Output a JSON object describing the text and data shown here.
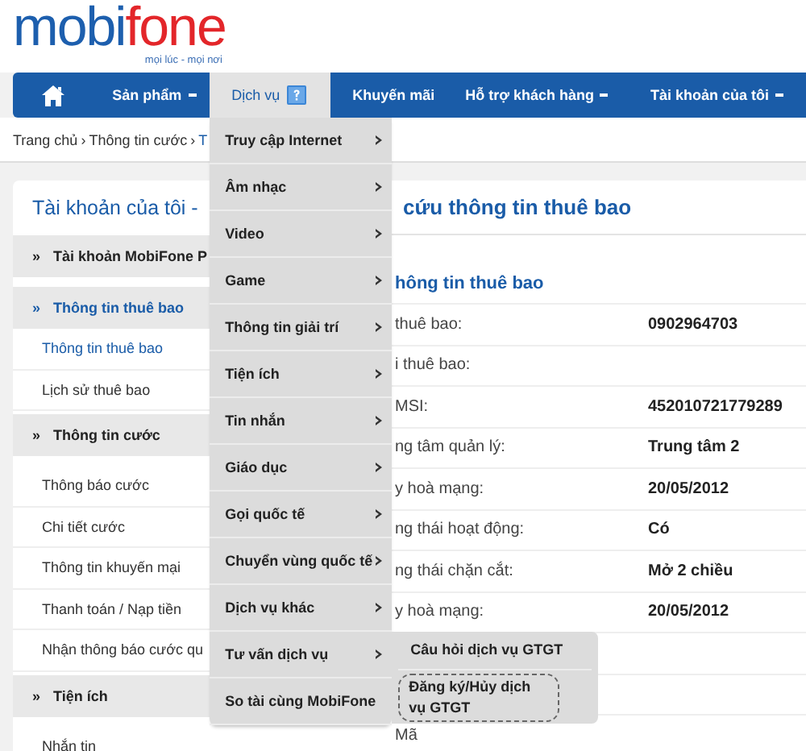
{
  "logo": {
    "part1": "mobi",
    "part2": "fone",
    "tagline": "mọi lúc - mọi nơi"
  },
  "nav": [
    {
      "kind": "home",
      "selected": false
    },
    {
      "kind": "menu",
      "label": "Sản phẩm",
      "has_menu": true,
      "selected": false
    },
    {
      "kind": "menu",
      "label": "Dịch vụ",
      "help": true,
      "selected": true,
      "dropdown": [
        {
          "label": "Truy cập Internet",
          "has_submenu": true
        },
        {
          "label": "Âm nhạc",
          "has_submenu": true
        },
        {
          "label": "Video",
          "has_submenu": true
        },
        {
          "label": "Game",
          "has_submenu": true
        },
        {
          "label": "Thông tin giải trí",
          "has_submenu": true
        },
        {
          "label": "Tiện ích",
          "has_submenu": true
        },
        {
          "label": "Tin nhắn",
          "has_submenu": true
        },
        {
          "label": "Giáo dục",
          "has_submenu": true
        },
        {
          "label": "Gọi quốc tế",
          "has_submenu": true
        },
        {
          "label": "Chuyển vùng quốc tế",
          "has_submenu": true
        },
        {
          "label": "Dịch vụ khác",
          "has_submenu": true
        },
        {
          "label": "Tư vấn dịch vụ",
          "has_submenu": true,
          "expanded": true,
          "submenu": [
            {
              "label": "Câu hỏi dịch vụ GTGT",
              "highlighted": false
            },
            {
              "label": "Đăng ký/Hủy dịch vụ GTGT",
              "highlighted": true
            }
          ]
        },
        {
          "label": "So tài cùng MobiFone",
          "has_submenu": false
        }
      ]
    },
    {
      "kind": "menu",
      "label": "Khuyến mãi",
      "has_menu": false,
      "selected": false
    },
    {
      "kind": "menu",
      "label": "Hỗ trợ khách hàng",
      "has_menu": true,
      "selected": false
    },
    {
      "kind": "menu",
      "label": "Tài khoản của tôi",
      "has_menu": true,
      "selected": false
    }
  ],
  "breadcrumb": {
    "separator": "›",
    "items": [
      "Trang chủ",
      "Thông tin cước",
      "T"
    ]
  },
  "sidebar": {
    "title": "Tài khoản của tôi",
    "title_caret": "-",
    "bullet": "»",
    "sections": [
      {
        "title": "Tài khoản MobiFone P",
        "selected": false
      },
      {
        "title": "Thông tin thuê bao",
        "selected": true,
        "items": [
          {
            "label": "Thông tin thuê bao",
            "selected": true
          },
          {
            "label": "Lịch sử thuê bao",
            "selected": false
          }
        ]
      },
      {
        "title": "Thông tin cước",
        "selected": false,
        "items": [
          {
            "label": "Thông báo cước",
            "selected": false
          },
          {
            "label": "Chi tiết cước",
            "selected": false
          },
          {
            "label": "Thông tin khuyến mại",
            "selected": false
          },
          {
            "label": "Thanh toán / Nạp tiền",
            "selected": false
          },
          {
            "label": "Nhận thông báo cước qu",
            "selected": false
          }
        ]
      },
      {
        "title": "Tiện ích",
        "selected": false,
        "items": [
          {
            "label": "Nhắn tin",
            "selected": false
          }
        ]
      }
    ]
  },
  "content": {
    "title": "cứu thông tin thuê bao",
    "subtitle": "hông tin thuê bao",
    "rows": [
      {
        "label": "thuê bao:",
        "value": "0902964703"
      },
      {
        "label": "i thuê bao:"
      },
      {
        "label": "MSI:",
        "value": "452010721779289"
      },
      {
        "label": "ng tâm quản lý:",
        "value": "Trung tâm 2"
      },
      {
        "label": "y hoà mạng:",
        "value": "20/05/2012"
      },
      {
        "label": "ng thái hoạt động:",
        "value": "Có"
      },
      {
        "label": "ng thái chặn cắt:",
        "value": "Mở 2 chiều"
      },
      {
        "label": "y hoà mạng:",
        "value": "20/05/2012"
      },
      {},
      {},
      {
        "label": "Mã"
      }
    ]
  }
}
